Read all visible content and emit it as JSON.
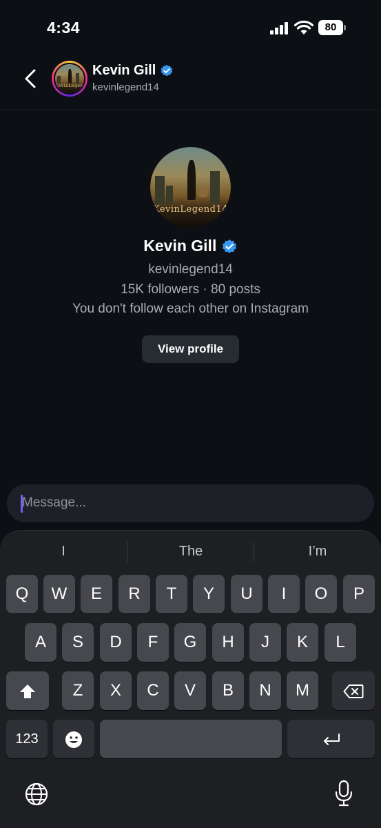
{
  "status_bar": {
    "time": "4:34",
    "battery": "80"
  },
  "header": {
    "name": "Kevin Gill",
    "username": "kevinlegend14",
    "poster_text": "KevinLegend14"
  },
  "profile": {
    "name": "Kevin Gill",
    "username": "kevinlegend14",
    "stats": "15K followers · 80 posts",
    "follow_status": "You don't follow each other on Instagram",
    "view_profile_label": "View profile",
    "poster_text": "KevinLegend14"
  },
  "composer": {
    "placeholder": "Message..."
  },
  "keyboard": {
    "suggestions": [
      "I",
      "The",
      "I’m"
    ],
    "row1": [
      "Q",
      "W",
      "E",
      "R",
      "T",
      "Y",
      "U",
      "I",
      "O",
      "P"
    ],
    "row2": [
      "A",
      "S",
      "D",
      "F",
      "G",
      "H",
      "J",
      "K",
      "L"
    ],
    "row3": [
      "Z",
      "X",
      "C",
      "V",
      "B",
      "N",
      "M"
    ],
    "numbers_label": "123",
    "icons": {
      "shift": "shift-icon",
      "delete": "delete-icon",
      "emoji": "emoji-icon",
      "return": "return-icon",
      "globe": "globe-icon",
      "mic": "microphone-icon"
    }
  },
  "colors": {
    "background": "#0c0f14",
    "verified": "#3897f0",
    "key": "#46484e",
    "key_dark": "#2e3035",
    "caret": "#7b5cff"
  }
}
